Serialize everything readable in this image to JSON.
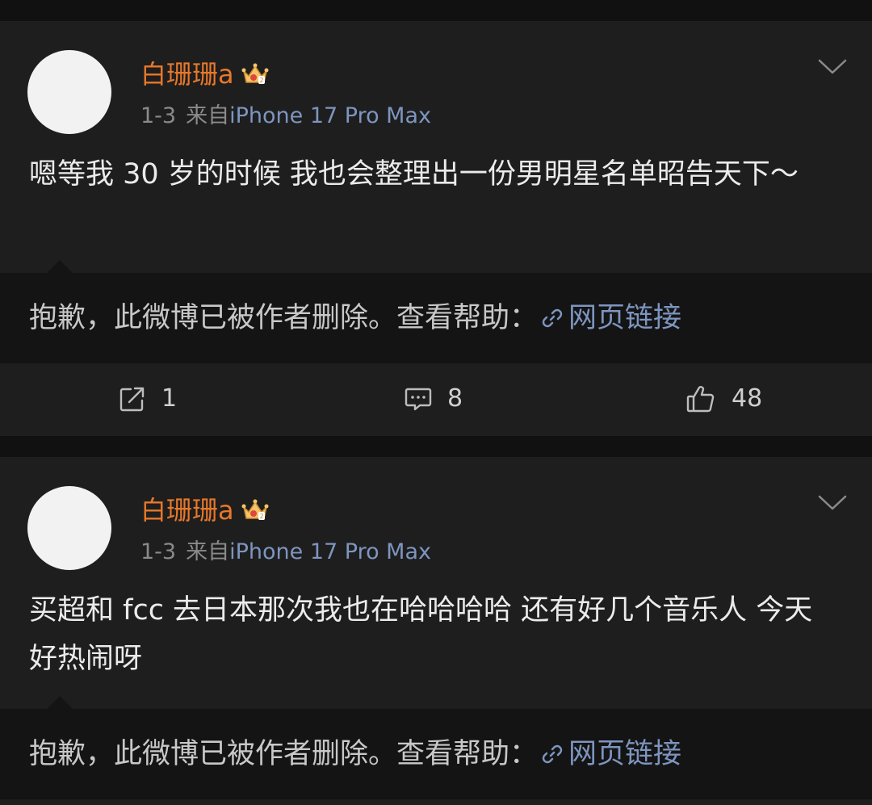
{
  "posts": [
    {
      "username": "白珊珊a",
      "date": "1-3",
      "from_label": "来自",
      "device": "iPhone 17 Pro Max",
      "content": "嗯等我 30 岁的时候 我也会整理出一份男明星名单昭告天下～",
      "deleted_notice": "抱歉，此微博已被作者删除。查看帮助：",
      "help_link": "网页链接",
      "reposts": "1",
      "comments": "8",
      "likes": "48"
    },
    {
      "username": "白珊珊a",
      "date": "1-3",
      "from_label": "来自",
      "device": "iPhone 17 Pro Max",
      "content": "买超和 fcc 去日本那次我也在哈哈哈哈 还有好几个音乐人 今天好热闹呀",
      "deleted_notice": "抱歉，此微博已被作者删除。查看帮助：",
      "help_link": "网页链接"
    }
  ],
  "icons": {
    "badge": "crown-badge-icon",
    "menu": "chevron-down-icon",
    "link": "link-icon",
    "repost": "repost-icon",
    "comment": "comment-icon",
    "like": "thumbs-up-icon"
  },
  "colors": {
    "background": "#111111",
    "card": "#1e1e1e",
    "quote_box": "#141414",
    "username": "#e8782a",
    "link": "#7d95bf",
    "meta": "#8a8a8a",
    "text": "#ebebeb"
  }
}
